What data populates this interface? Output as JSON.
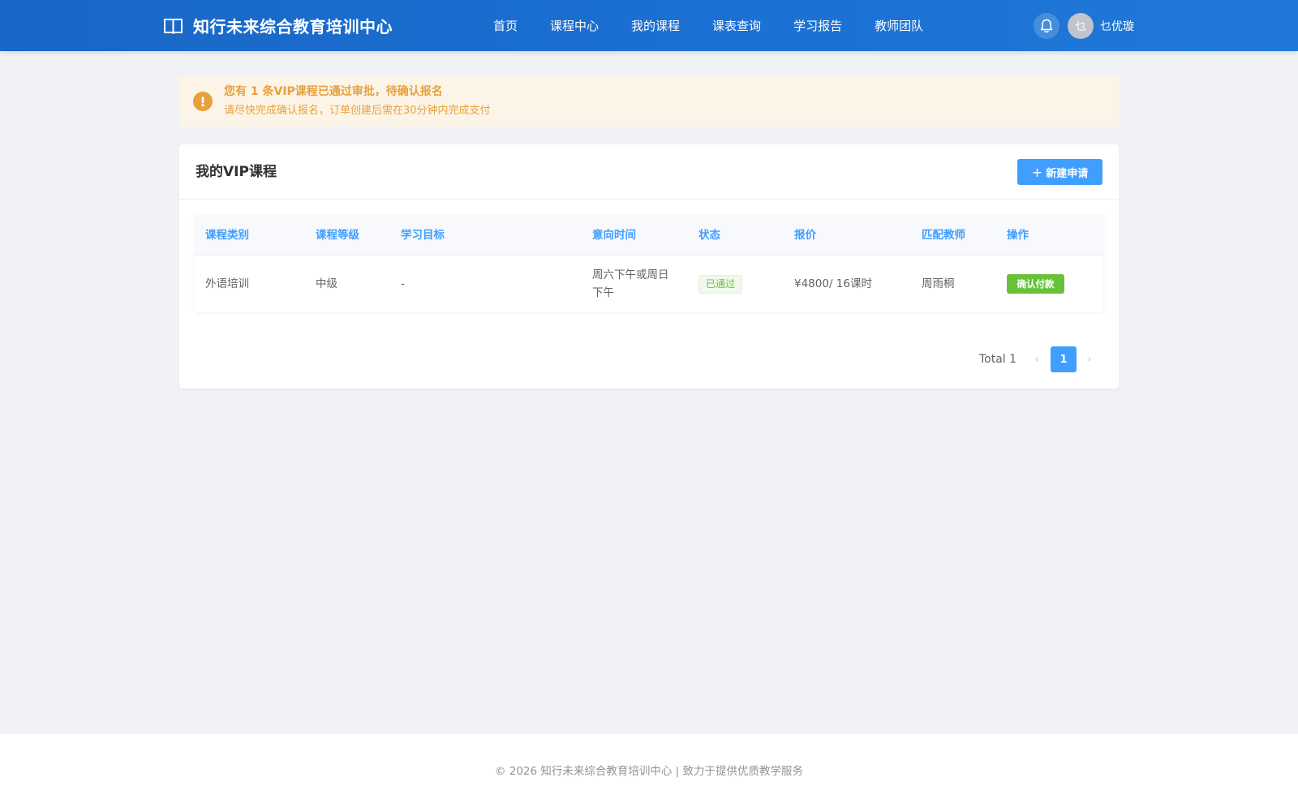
{
  "header": {
    "brand_title": "知行未来综合教育培训中心",
    "nav": [
      {
        "label": "首页"
      },
      {
        "label": "课程中心"
      },
      {
        "label": "我的课程"
      },
      {
        "label": "课表查询"
      },
      {
        "label": "学习报告"
      },
      {
        "label": "教师团队"
      }
    ],
    "avatar_initial": "乜",
    "username": "乜优璇",
    "icons": {
      "brand": "book-open-icon",
      "bell": "bell-icon"
    }
  },
  "alert": {
    "icon": "!",
    "title": "您有 1 条VIP课程已通过审批，待确认报名",
    "description": "请尽快完成确认报名，订单创建后需在30分钟内完成支付"
  },
  "card": {
    "title": "我的VIP课程",
    "new_button": {
      "icon": "+",
      "label": "新建申请"
    }
  },
  "table": {
    "columns": [
      "课程类别",
      "课程等级",
      "学习目标",
      "意向时间",
      "状态",
      "报价",
      "匹配教师",
      "操作"
    ],
    "rows": [
      {
        "category": "外语培训",
        "level": "中级",
        "goal": "-",
        "time": "周六下午或周日下午",
        "status": "已通过",
        "price": "¥4800/ 16课时",
        "teacher": "周雨桐",
        "action": "确认付款"
      }
    ]
  },
  "pagination": {
    "total_label": "Total 1",
    "current_page": "1",
    "prev": "‹",
    "next": "›"
  },
  "footer": {
    "text": "© 2026 知行未来综合教育培训中心 | 致力于提供优质教学服务"
  },
  "colors": {
    "header": "#1b70d3",
    "primary": "#409eff",
    "warning": "#e6a23c",
    "success": "#67c23a",
    "background": "#f0f2f5"
  }
}
